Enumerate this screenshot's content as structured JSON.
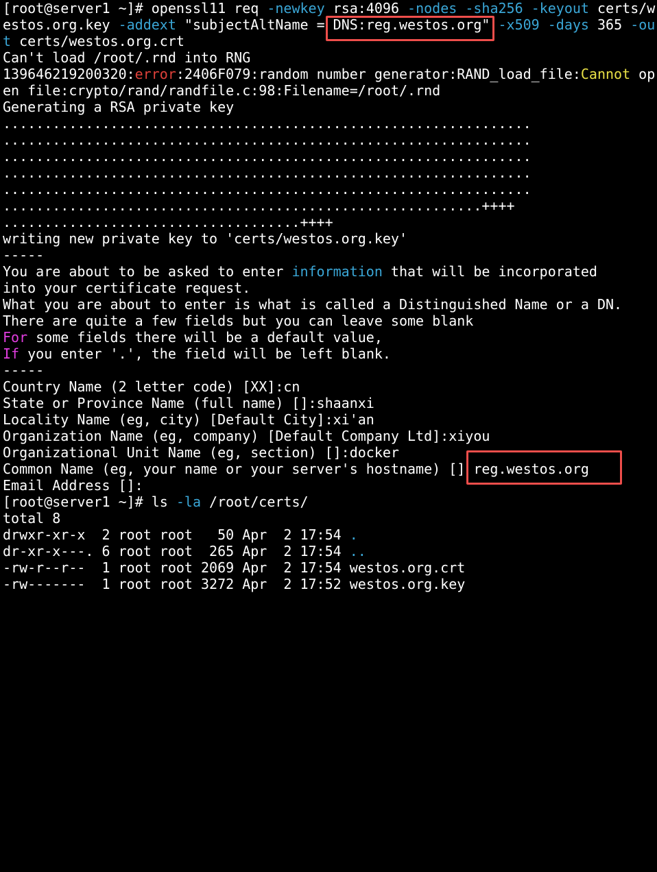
{
  "terminal": {
    "cmd1": {
      "prompt": "[root@server1 ~]# ",
      "cmd": "openssl11 req ",
      "opt_newkey": "-newkey",
      "newkey_val": " rsa:4096 ",
      "opt_nodes": "-nodes",
      "sp1": " ",
      "opt_sha256": "-sha256",
      "sp2": " ",
      "opt_keyout": "-keyout",
      "keyout_val_a": " certs/w",
      "keyout_val_b": "estos.org.key ",
      "opt_addext": "-addext",
      "addext_val_pre": " \"subjectAltName = ",
      "addext_val_dns": "DNS:reg.westos.org\"",
      "sp3": " ",
      "opt_x509": "-x509",
      "sp4": " ",
      "opt_days": "-days",
      "days_val": " 365 ",
      "opt_out_a": "-ou",
      "opt_out_b": "t",
      "out_val": " certs/westos.org.crt"
    },
    "rng_line": "Can't load /root/.rnd into RNG",
    "err_line": {
      "pre": "139646219200320:",
      "error": "error",
      "mid": ":2406F079:random number generator:RAND_load_file:",
      "cannot": "Cannot",
      "post": " op"
    },
    "err_line2": "en file:crypto/rand/randfile.c:98:Filename=/root/.rnd",
    "gen_line": "Generating a RSA private key",
    "dots": [
      "................................................................",
      "................................................................",
      "................................................................",
      "................................................................",
      "................................................................",
      "..........................................................++++",
      "....................................++++"
    ],
    "write_line": "writing new private key to 'certs/westos.org.key'",
    "sep": "-----",
    "info": {
      "l1_pre": "You are about to be asked to enter ",
      "l1_info": "information",
      "l1_post": " that will be incorporated",
      "l2": "into your certificate request.",
      "l3": "What you are about to enter is what is called a Distinguished Name or a DN.",
      "l4": "There are quite a few fields but you can leave some blank",
      "l5_kw": "For",
      "l5_rest": " some fields there will be a default value,",
      "l6_kw": "If",
      "l6_rest": " you enter '.', the field will be left blank."
    },
    "fields": {
      "country": "Country Name (2 letter code) [XX]:cn",
      "state": "State or Province Name (full name) []:shaanxi",
      "locality": "Locality Name (eg, city) [Default City]:xi'an",
      "org": "Organization Name (eg, company) [Default Company Ltd]:xiyou",
      "unit": "Organizational Unit Name (eg, section) []:docker",
      "cn_prompt": "Common Name (eg, your name or your server's hostname) [] ",
      "cn_value": "reg.westos.org",
      "email": "Email Address []:"
    },
    "cmd2": {
      "prompt": "[root@server1 ~]# ",
      "cmd": "ls ",
      "opt": "-la",
      "path": " /root/certs/"
    },
    "total": "total 8",
    "listing": [
      {
        "meta": "drwxr-xr-x  2 root root   50 Apr  2 17:54 ",
        "name": ".",
        "colored": true
      },
      {
        "meta": "dr-xr-x---. 6 root root  265 Apr  2 17:54 ",
        "name": "..",
        "colored": true
      },
      {
        "meta": "-rw-r--r--  1 root root 2069 Apr  2 17:54 ",
        "name": "westos.org.crt",
        "colored": false
      },
      {
        "meta": "-rw-------  1 root root 3272 Apr  2 17:52 ",
        "name": "westos.org.key",
        "colored": false
      }
    ]
  },
  "colors": {
    "background": "#000000",
    "text": "#ffffff",
    "option_cyan": "#3aa6d6",
    "error_red": "#e0413a",
    "warning_yellow": "#e8e046",
    "keyword_magenta": "#e23de0",
    "highlight_box": "#ee4e4b"
  }
}
